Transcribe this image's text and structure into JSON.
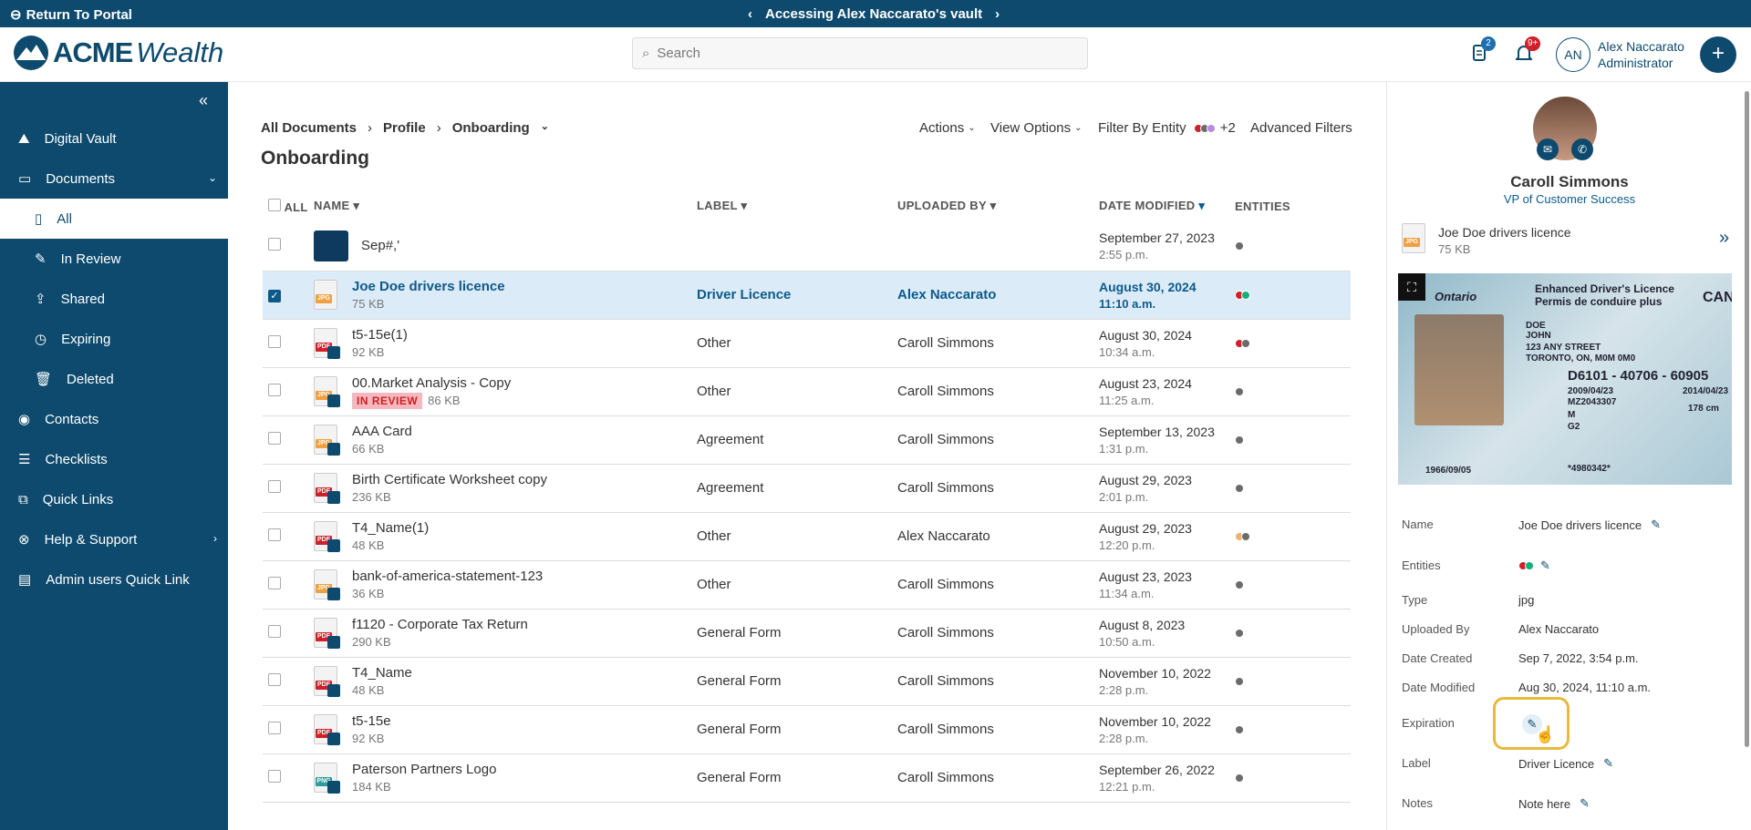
{
  "topbar": {
    "return_label": "Return To Portal",
    "vault_label": "Accessing Alex Naccarato's vault"
  },
  "header": {
    "logo_acme": "ACME",
    "logo_wealth": "Wealth",
    "search_placeholder": "Search",
    "doc_badge": "2",
    "bell_badge": "9+",
    "user_initials": "AN",
    "user_name": "Alex Naccarato",
    "user_role": "Administrator"
  },
  "sidebar": {
    "items": [
      {
        "label": "Digital Vault",
        "icon": "mountain-icon"
      },
      {
        "label": "Documents",
        "icon": "folder-icon"
      },
      {
        "label": "All",
        "icon": "file-icon"
      },
      {
        "label": "In Review",
        "icon": "file-edit-icon"
      },
      {
        "label": "Shared",
        "icon": "share-icon"
      },
      {
        "label": "Expiring",
        "icon": "clock-file-icon"
      },
      {
        "label": "Deleted",
        "icon": "trash-icon"
      },
      {
        "label": "Contacts",
        "icon": "user-circle-icon"
      },
      {
        "label": "Checklists",
        "icon": "checklist-icon"
      },
      {
        "label": "Quick Links",
        "icon": "external-link-icon"
      },
      {
        "label": "Help & Support",
        "icon": "lifebuoy-icon"
      },
      {
        "label": "Admin users Quick Link",
        "icon": "list-icon"
      }
    ]
  },
  "main": {
    "crumbs": [
      "All Documents",
      "Profile",
      "Onboarding"
    ],
    "title": "Onboarding",
    "actions": "Actions",
    "view_options": "View Options",
    "filter_entity": "Filter By Entity",
    "filter_more": "+2",
    "advanced": "Advanced Filters",
    "columns": {
      "all": "ALL",
      "name": "NAME",
      "label": "LABEL",
      "uploaded": "UPLOADED BY",
      "date": "DATE MODIFIED",
      "entities": "ENTITIES"
    },
    "rows": [
      {
        "name": "Sep#,'",
        "size": "",
        "label": "",
        "by": "",
        "date": "September 27, 2023",
        "time": "2:55 p.m."
      },
      {
        "name": "Joe Doe drivers licence",
        "size": "75 KB",
        "label": "Driver Licence",
        "by": "Alex Naccarato",
        "date": "August 30, 2024",
        "time": "11:10 a.m."
      },
      {
        "name": "t5-15e(1)",
        "size": "92 KB",
        "label": "Other",
        "by": "Caroll Simmons",
        "date": "August 30, 2024",
        "time": "10:34 a.m."
      },
      {
        "name": "00.Market Analysis - Copy",
        "size": "86 KB",
        "badge": "IN REVIEW",
        "label": "Other",
        "by": "Caroll Simmons",
        "date": "August 23, 2024",
        "time": "11:25 a.m."
      },
      {
        "name": "AAA Card",
        "size": "66 KB",
        "label": "Agreement",
        "by": "Caroll Simmons",
        "date": "September 13, 2023",
        "time": "1:31 p.m."
      },
      {
        "name": "Birth Certificate Worksheet copy",
        "size": "236 KB",
        "label": "Agreement",
        "by": "Caroll Simmons",
        "date": "August 29, 2023",
        "time": "2:01 p.m."
      },
      {
        "name": "T4_Name(1)",
        "size": "48 KB",
        "label": "Other",
        "by": "Alex Naccarato",
        "date": "August 29, 2023",
        "time": "12:20 p.m."
      },
      {
        "name": "bank-of-america-statement-123",
        "size": "36 KB",
        "label": "Other",
        "by": "Caroll Simmons",
        "date": "August 23, 2023",
        "time": "11:34 a.m."
      },
      {
        "name": "f1120 - Corporate Tax Return",
        "size": "290 KB",
        "label": "General Form",
        "by": "Caroll Simmons",
        "date": "August 8, 2023",
        "time": "10:50 a.m."
      },
      {
        "name": "T4_Name",
        "size": "48 KB",
        "label": "General Form",
        "by": "Caroll Simmons",
        "date": "November 10, 2022",
        "time": "2:28 p.m."
      },
      {
        "name": "t5-15e",
        "size": "92 KB",
        "label": "General Form",
        "by": "Caroll Simmons",
        "date": "November 10, 2022",
        "time": "2:28 p.m."
      },
      {
        "name": "Paterson Partners Logo",
        "size": "184 KB",
        "label": "General Form",
        "by": "Caroll Simmons",
        "date": "September 26, 2022",
        "time": "12:21 p.m."
      }
    ],
    "filetypes": [
      "",
      "JPG",
      "PDF",
      "JPG",
      "JPG",
      "PDF",
      "PDF",
      "JPG",
      "PDF",
      "PDF",
      "PDF",
      "PNG"
    ]
  },
  "panel": {
    "name": "Caroll Simmons",
    "role": "VP of Customer Success",
    "file_name": "Joe Doe drivers licence",
    "file_size": "75 KB",
    "licence": {
      "province": "Ontario",
      "title": "Enhanced Driver's Licence",
      "title_fr": "Permis de conduire plus",
      "country": "CAN",
      "surname": "DOE",
      "given": "JOHN",
      "addr1": "123 ANY STREET",
      "addr2": "TORONTO, ON, M0M 0M0",
      "number": "D6101 - 40706 - 60905",
      "issued": "2009/04/23",
      "expiry": "2014/04/23",
      "ref": "MZ2043307",
      "sex": "M",
      "height": "178 cm",
      "class": "G2",
      "dob": "1966/09/05",
      "code": "*4980342*"
    },
    "fields": {
      "name_l": "Name",
      "name_v": "Joe Doe drivers licence",
      "entities_l": "Entities",
      "type_l": "Type",
      "type_v": "jpg",
      "uploaded_l": "Uploaded By",
      "uploaded_v": "Alex Naccarato",
      "created_l": "Date Created",
      "created_v": "Sep 7, 2022, 3:54 p.m.",
      "modified_l": "Date Modified",
      "modified_v": "Aug 30, 2024, 11:10 a.m.",
      "expiration_l": "Expiration",
      "label_l": "Label",
      "label_v": "Driver Licence",
      "notes_l": "Notes",
      "notes_v": "Note here"
    }
  },
  "colors": {
    "brand": "#0d4a6e",
    "red": "#d0202a",
    "green": "#12b07a",
    "grey": "#6b6b6b",
    "orange": "#f0b070",
    "purple": "#b58be0",
    "highlight": "#e8b93a"
  }
}
